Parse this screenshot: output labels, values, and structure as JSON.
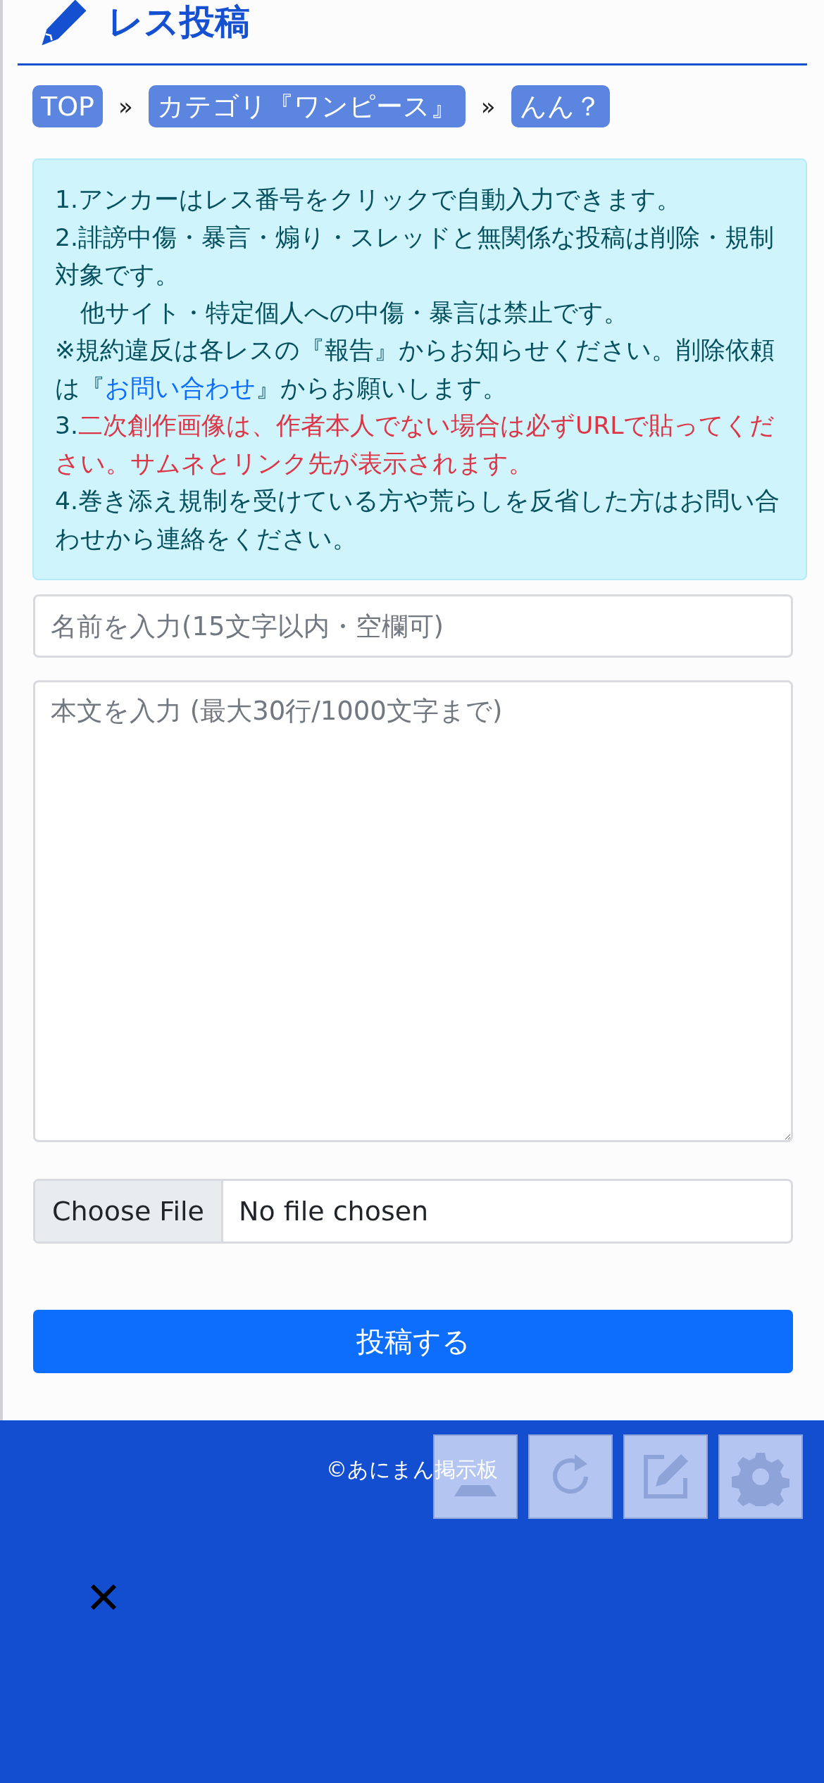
{
  "header": {
    "title": "レス投稿"
  },
  "breadcrumbs": [
    {
      "label": "TOP"
    },
    {
      "label": "カテゴリ『ワンピース』"
    },
    {
      "label": "んん？"
    }
  ],
  "breadcrumb_separator": "»",
  "notice": {
    "paragraphs": [
      {
        "indented": false,
        "segments": [
          {
            "kind": "plain",
            "text": "1.アンカーはレス番号をクリックで自動入力できます。"
          }
        ]
      },
      {
        "indented": false,
        "segments": [
          {
            "kind": "plain",
            "text": "2.誹謗中傷・暴言・煽り・スレッドと無関係な投稿は削除・規制対象です。"
          }
        ]
      },
      {
        "indented": true,
        "segments": [
          {
            "kind": "plain",
            "text": "他サイト・特定個人への中傷・暴言は禁止です。"
          }
        ]
      },
      {
        "indented": false,
        "segments": [
          {
            "kind": "plain",
            "text": "※規約違反は各レスの『報告』からお知らせください。削除依頼は『"
          },
          {
            "kind": "link",
            "text": "お問い合わせ"
          },
          {
            "kind": "plain",
            "text": "』からお願いします。"
          }
        ]
      },
      {
        "indented": false,
        "segments": [
          {
            "kind": "plain",
            "text": "3."
          },
          {
            "kind": "warning",
            "text": "二次創作画像は、作者本人でない場合は必ずURLで貼ってください。サムネとリンク先が表示されます。"
          }
        ]
      },
      {
        "indented": false,
        "segments": [
          {
            "kind": "plain",
            "text": "4.巻き添え規制を受けている方や荒らしを反省した方はお問い合わせから連絡をください。"
          }
        ]
      }
    ]
  },
  "form": {
    "name_field": {
      "placeholder": "名前を入力(15文字以内・空欄可)"
    },
    "body_field": {
      "placeholder": "本文を入力 (最大30行/1000文字まで)"
    },
    "file_field": {
      "button": "Choose File",
      "status": "No file chosen"
    },
    "submit": "投稿する"
  },
  "footer": {
    "copyright": "©あにまん掲示板"
  },
  "floating_buttons": [
    {
      "kind": "top"
    },
    {
      "kind": "reload"
    },
    {
      "kind": "edit"
    },
    {
      "kind": "settings"
    }
  ]
}
